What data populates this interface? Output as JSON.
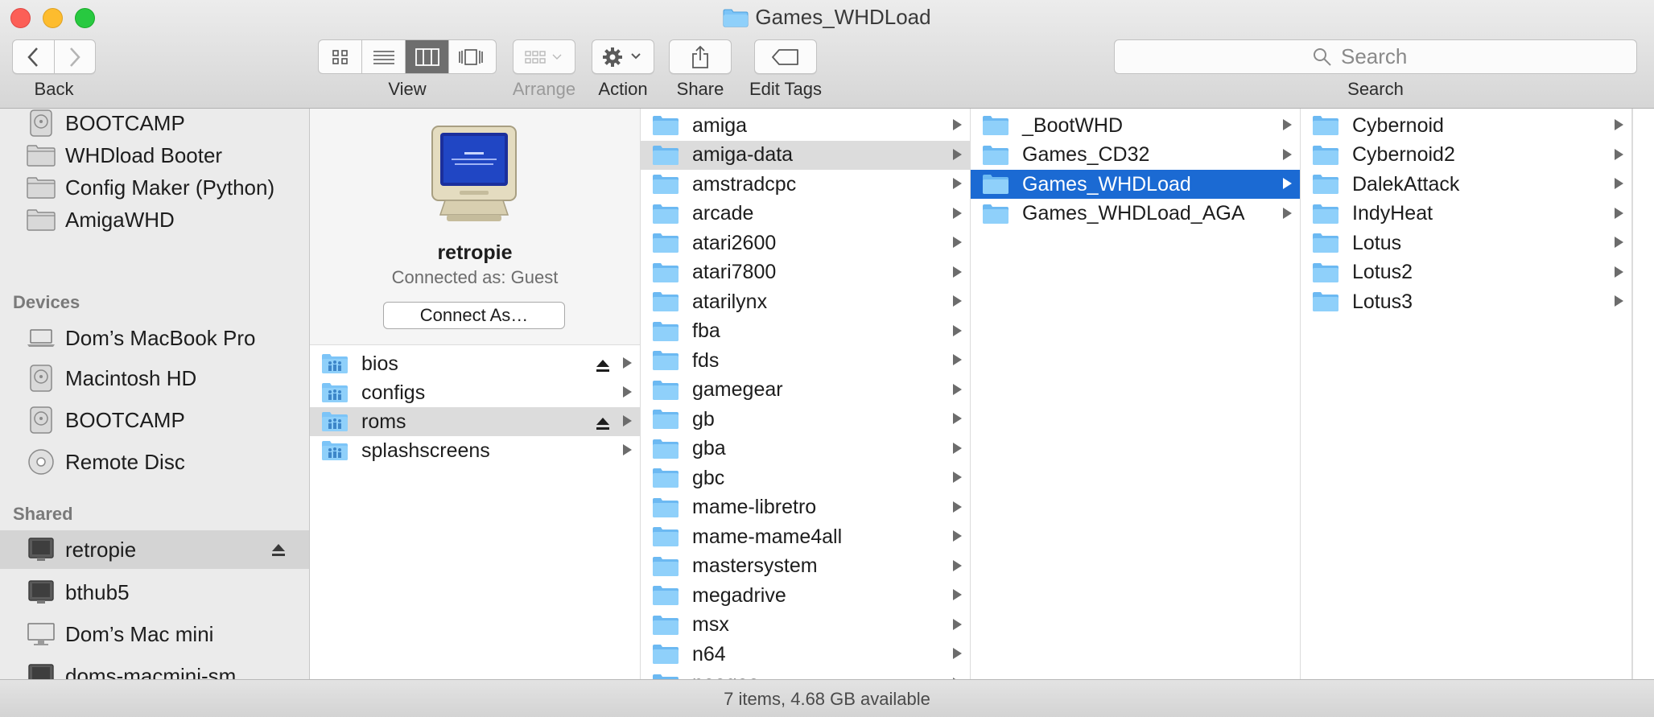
{
  "window": {
    "title": "Games_WHDLoad",
    "colors": {
      "selection": "#1b6ad3",
      "folder": "#6fbef5",
      "sidebar_bg": "#ebebeb"
    }
  },
  "toolbar": {
    "back_label": "Back",
    "view_label": "View",
    "arrange_label": "Arrange",
    "action_label": "Action",
    "share_label": "Share",
    "edit_tags_label": "Edit Tags",
    "search_label": "Search",
    "search_placeholder": "Search",
    "active_view": "columns"
  },
  "sidebar": {
    "favorites": [
      {
        "label": "BOOTCAMP",
        "icon": "drive-icon"
      },
      {
        "label": "WHDload Booter",
        "icon": "folder-icon"
      },
      {
        "label": "Config Maker (Python)",
        "icon": "folder-icon"
      },
      {
        "label": "AmigaWHD",
        "icon": "folder-icon"
      }
    ],
    "devices_heading": "Devices",
    "devices": [
      {
        "label": "Dom’s MacBook Pro",
        "icon": "laptop-icon"
      },
      {
        "label": "Macintosh HD",
        "icon": "drive-icon"
      },
      {
        "label": "BOOTCAMP",
        "icon": "drive-icon"
      },
      {
        "label": "Remote Disc",
        "icon": "disc-icon"
      }
    ],
    "shared_heading": "Shared",
    "shared": [
      {
        "label": "retropie",
        "icon": "monitor-icon",
        "selected": true
      },
      {
        "label": "bthub5",
        "icon": "monitor-icon"
      },
      {
        "label": "Dom’s Mac mini",
        "icon": "monitor-icon"
      },
      {
        "label": "doms-macmini-sm",
        "icon": "monitor-icon"
      }
    ]
  },
  "server": {
    "name": "retropie",
    "connected_as": "Connected as: Guest",
    "connect_button": "Connect As…",
    "shares": [
      {
        "label": "bios",
        "eject": true
      },
      {
        "label": "configs",
        "eject": false
      },
      {
        "label": "roms",
        "eject": true,
        "highlighted": true
      },
      {
        "label": "splashscreens",
        "eject": false
      }
    ]
  },
  "column2": {
    "items": [
      "amiga",
      "amiga-data",
      "amstradcpc",
      "arcade",
      "atari2600",
      "atari7800",
      "atarilynx",
      "fba",
      "fds",
      "gamegear",
      "gb",
      "gba",
      "gbc",
      "mame-libretro",
      "mame-mame4all",
      "mastersystem",
      "megadrive",
      "msx",
      "n64",
      "neogeo"
    ],
    "highlighted": "amiga-data"
  },
  "column3": {
    "items": [
      "_BootWHD",
      "Games_CD32",
      "Games_WHDLoad",
      "Games_WHDLoad_AGA"
    ],
    "selected": "Games_WHDLoad"
  },
  "column4": {
    "items": [
      "Cybernoid",
      "Cybernoid2",
      "DalekAttack",
      "IndyHeat",
      "Lotus",
      "Lotus2",
      "Lotus3"
    ]
  },
  "status": {
    "text": "7 items, 4.68 GB available"
  }
}
